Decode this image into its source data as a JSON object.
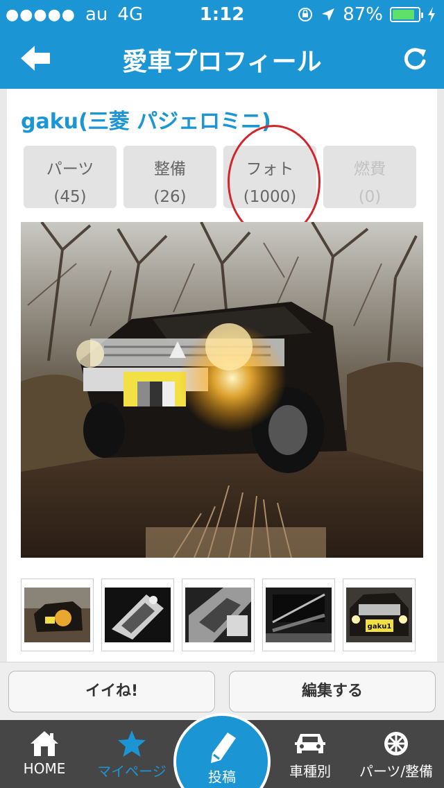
{
  "status_bar": {
    "carrier": "au",
    "network": "4G",
    "time": "1:12",
    "battery": "87%",
    "battery_level": 0.87
  },
  "nav": {
    "title": "愛車プロフィール",
    "back_icon": "back-arrow-icon",
    "refresh_icon": "refresh-icon"
  },
  "profile": {
    "title": "gaku(三菱 パジェロミニ)"
  },
  "stats": [
    {
      "label": "パーツ",
      "count": "(45)"
    },
    {
      "label": "整備",
      "count": "(26)"
    },
    {
      "label": "フォト",
      "count": "(1000)"
    },
    {
      "label": "燃費",
      "count": "(0)"
    }
  ],
  "thumbnails": [
    {
      "icon": "car-photo-icon"
    },
    {
      "icon": "part-photo-icon"
    },
    {
      "icon": "part-photo-icon"
    },
    {
      "icon": "sign-photo-icon"
    },
    {
      "icon": "car-front-photo-icon",
      "plate_text": "gaku1"
    }
  ],
  "actions": {
    "like_label": "イイね!",
    "edit_label": "編集する"
  },
  "tabbar": {
    "home": "HOME",
    "mypage": "マイページ",
    "post": "投稿",
    "cars": "車種別",
    "parts": "パーツ/整備"
  },
  "colors": {
    "brand_blue": "#1b95d3",
    "highlight_red": "#d2252b",
    "tabbar_bg": "#464646"
  }
}
